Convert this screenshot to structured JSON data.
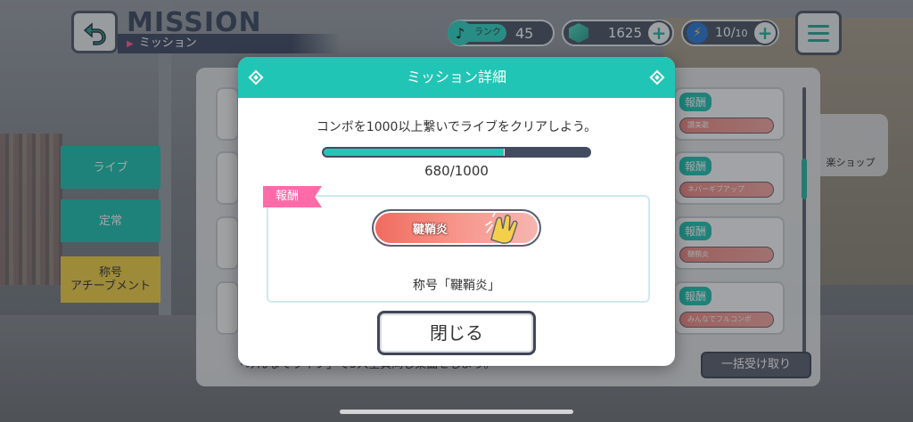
{
  "header": {
    "title": "MISSION",
    "subtitle": "ミッション",
    "rank_label": "ランク",
    "rank_value": "45",
    "gems": "1625",
    "energy": "10/",
    "energy_max": "10"
  },
  "side_tabs": [
    {
      "label": "ライブ"
    },
    {
      "label": "定常"
    },
    {
      "label": "称号\nアチーブメント"
    }
  ],
  "list": {
    "reward_tag": "報酬",
    "reward_chips": [
      "讃美歌",
      "ネバーギブアップ",
      "鞬鞘炎",
      "みんなでフルコンボ"
    ],
    "bulk_receive": "一括受け取り",
    "shop_label": "楽ショップ",
    "bottom_text": "「みんなでライブ」で5人全員同じ楽曲をしよう。"
  },
  "modal": {
    "title": "ミッション詳細",
    "description": "コンボを1000以上繋いでライブをクリアしよう。",
    "progress_current": 680,
    "progress_max": 1000,
    "progress_text": "680/1000",
    "reward_label": "報酬",
    "badge_text": "鞬鞘炎",
    "reward_name": "称号「鞬鞘炎」",
    "close_label": "閉じる"
  },
  "colors": {
    "accent": "#21c5b5",
    "reward_pink": "#ff6aa8",
    "navy": "#434b60"
  }
}
